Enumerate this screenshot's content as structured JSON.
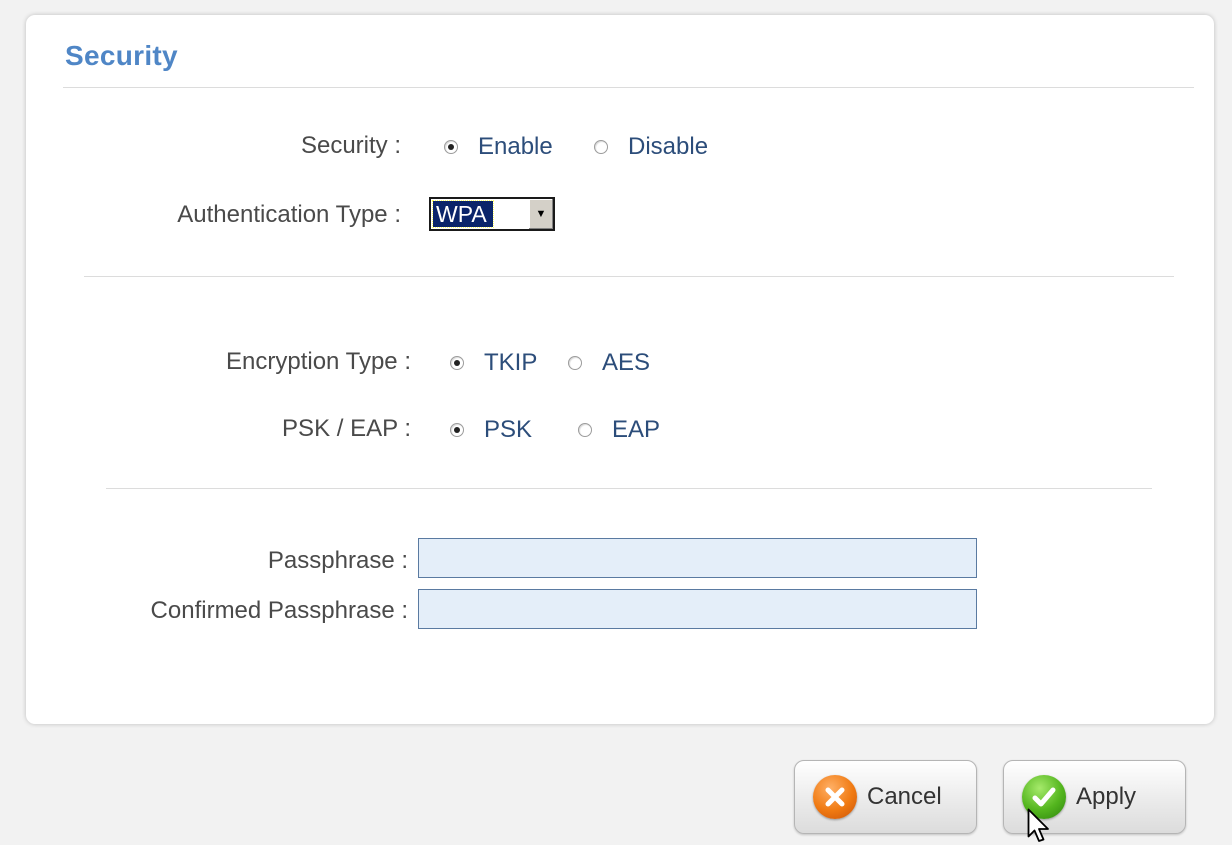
{
  "section": {
    "title": "Security"
  },
  "security": {
    "label": "Security :",
    "options": [
      {
        "label": "Enable",
        "checked": true
      },
      {
        "label": "Disable",
        "checked": false
      }
    ]
  },
  "auth": {
    "label": "Authentication Type :",
    "selected": "WPA"
  },
  "encryption": {
    "label": "Encryption Type :",
    "options": [
      {
        "label": "TKIP",
        "checked": true
      },
      {
        "label": "AES",
        "checked": false
      }
    ]
  },
  "pskeap": {
    "label": "PSK / EAP :",
    "options": [
      {
        "label": "PSK",
        "checked": true
      },
      {
        "label": "EAP",
        "checked": false
      }
    ]
  },
  "passphrase": {
    "label": "Passphrase :",
    "value": ""
  },
  "confirm": {
    "label": "Confirmed Passphrase :",
    "value": ""
  },
  "buttons": {
    "cancel": "Cancel",
    "apply": "Apply"
  },
  "colors": {
    "title": "#4f86c6",
    "option_text": "#2c4d7a",
    "input_bg": "#e4eef9"
  }
}
